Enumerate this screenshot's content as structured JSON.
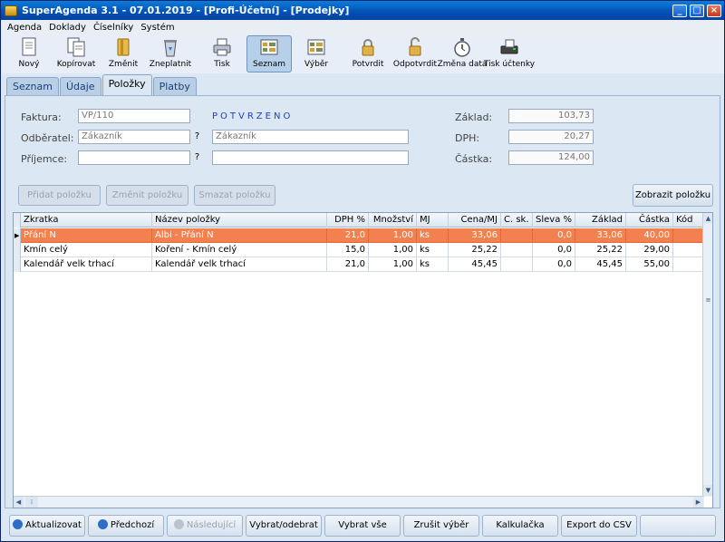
{
  "window": {
    "title": "SuperAgenda 3.1 - 07.01.2019 - [Profi-Účetní] - [Prodejky]"
  },
  "menu": [
    "Agenda",
    "Doklady",
    "Číselníky",
    "Systém"
  ],
  "toolbar": [
    {
      "label": "Nový",
      "icon": "new-document-icon"
    },
    {
      "label": "Kopírovat",
      "icon": "copy-document-icon"
    },
    {
      "label": "Změnit",
      "icon": "edit-folder-icon"
    },
    {
      "label": "Zneplatnit",
      "icon": "recycle-bin-icon"
    },
    {
      "label": "Tisk",
      "icon": "printer-icon"
    },
    {
      "label": "Seznam",
      "icon": "list-view-icon"
    },
    {
      "label": "Výběr",
      "icon": "filter-view-icon"
    },
    {
      "label": "Potvrdit",
      "icon": "lock-closed-icon"
    },
    {
      "label": "Odpotvrdit",
      "icon": "lock-open-icon"
    },
    {
      "label": "Změna data",
      "icon": "stopwatch-icon"
    },
    {
      "label": "Tisk účtenky",
      "icon": "receipt-printer-icon"
    }
  ],
  "tabs": [
    "Seznam",
    "Údaje",
    "Položky",
    "Platby"
  ],
  "form": {
    "faktura_label": "Faktura:",
    "faktura_value": "VP/110",
    "status": "POTVRZENO",
    "odberatel_label": "Odběratel:",
    "odberatel_value": "Zákazník",
    "odberatel_name": "Zákazník",
    "prijemce_label": "Příjemce:",
    "prijemce_value": "",
    "prijemce_name": "",
    "lookup_label": "?",
    "zaklad_label": "Základ:",
    "zaklad_value": "103,73",
    "dph_label": "DPH:",
    "dph_value": "20,27",
    "castka_label": "Částka:",
    "castka_value": "124,00"
  },
  "actions": {
    "add": "Přidat položku",
    "edit": "Změnit položku",
    "delete": "Smazat položku",
    "show": "Zobrazit položku"
  },
  "grid": {
    "columns": [
      "Zkratka",
      "Název položky",
      "DPH %",
      "Množství",
      "MJ",
      "Cena/MJ",
      "C. sk.",
      "Sleva %",
      "Základ",
      "Částka",
      "Kód"
    ],
    "rows": [
      [
        "Přání N",
        "Albi - Přání N",
        "21,0",
        "1,00",
        "ks",
        "33,06",
        "",
        "0,0",
        "33,06",
        "40,00",
        ""
      ],
      [
        "Kmín celý",
        "Koření - Kmín celý",
        "15,0",
        "1,00",
        "ks",
        "25,22",
        "",
        "0,0",
        "25,22",
        "29,00",
        ""
      ],
      [
        "Kalendář velk trhací",
        "Kalendář velk trhací",
        "21,0",
        "1,00",
        "ks",
        "45,45",
        "",
        "0,0",
        "45,45",
        "55,00",
        ""
      ]
    ],
    "selected_row": 0
  },
  "bottom": [
    {
      "label": "Aktualizovat",
      "icon": "refresh-icon",
      "disabled": false
    },
    {
      "label": "Předchozí",
      "icon": "previous-icon",
      "disabled": false
    },
    {
      "label": "Následující",
      "icon": "next-icon",
      "disabled": true
    },
    {
      "label": "Vybrat/odebrat",
      "disabled": false
    },
    {
      "label": "Vybrat vše",
      "disabled": false
    },
    {
      "label": "Zrušit výběr",
      "disabled": false
    },
    {
      "label": "Kalkulačka",
      "disabled": false
    },
    {
      "label": "Export do CSV",
      "disabled": false
    },
    {
      "label": "",
      "disabled": false
    }
  ],
  "colors": {
    "selection": "#f2814f",
    "status": "#2440b8",
    "title": "#0453b7"
  }
}
